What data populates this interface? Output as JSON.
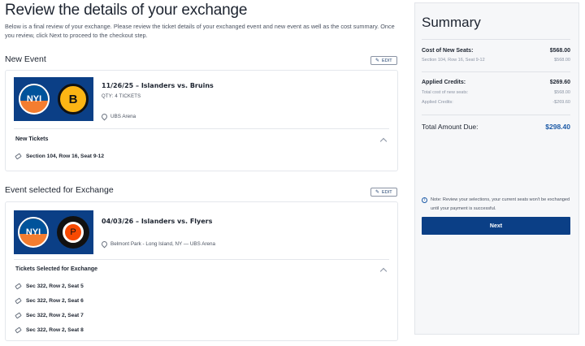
{
  "header": {
    "title": "Review the details of your exchange",
    "intro": "Below is a final review of your exchange. Please review the ticket details of your exchanged event and new event as well as the cost summary. Once you review, click Next to proceed to the checkout step."
  },
  "new_event": {
    "section_title": "New Event",
    "edit_label": "EDIT",
    "name": "11/26/25 – Islanders vs. Bruins",
    "qty": "QTY: 4 TICKETS",
    "venue": "UBS Arena",
    "tickets_title": "New Tickets",
    "tickets": [
      "Section 104, Row 16, Seat 9-12"
    ],
    "home_logo": "NYI",
    "away_logo": "B"
  },
  "exchange_event": {
    "section_title": "Event selected for Exchange",
    "edit_label": "EDIT",
    "name": "04/03/26 – Islanders vs. Flyers",
    "venue": "Belmont Park - Long Island, NY — UBS Arena",
    "tickets_title": "Tickets Selected for Exchange",
    "tickets": [
      "Sec 322, Row 2, Seat 5",
      "Sec 322, Row 2, Seat 6",
      "Sec 322, Row 2, Seat 7",
      "Sec 322, Row 2, Seat 8"
    ],
    "home_logo": "NYI",
    "away_logo": "P"
  },
  "summary": {
    "title": "Summary",
    "cost_label": "Cost of New Seats:",
    "cost_value": "$568.00",
    "cost_detail_label": "Section 104, Row 16, Seat 9-12",
    "cost_detail_value": "$568.00",
    "credits_label": "Applied Credits:",
    "credits_value": "$269.60",
    "total_cost_label": "Total cost of new seats:",
    "total_cost_value": "$568.00",
    "applied_credits_label": "Applied Credits:",
    "applied_credits_value": "-$269.60",
    "total_due_label": "Total Amount Due:",
    "total_due_value": "$298.40",
    "note": "Note: Review your selections, your current seats won't be exchanged until your payment is successful.",
    "next_label": "Next"
  },
  "colors": {
    "brand_navy": "#0b3f86",
    "total_blue": "#1c5aa6",
    "summary_bg": "#f6f7f9"
  }
}
